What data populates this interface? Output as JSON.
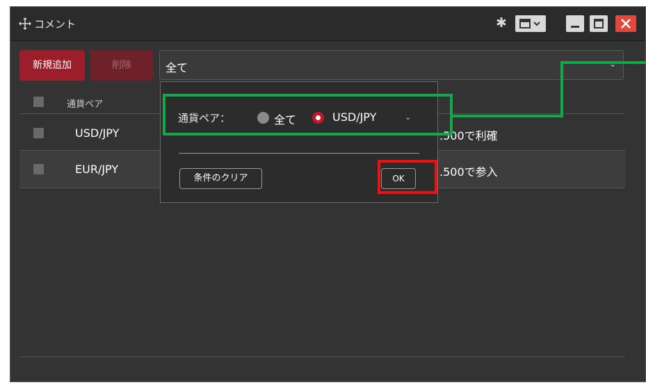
{
  "window": {
    "title": "コメント",
    "icons": [
      "move-icon",
      "gear-icon",
      "layout-icon",
      "minimize-icon",
      "maximize-icon",
      "close-icon"
    ]
  },
  "toolbar": {
    "add_label": "新規追加",
    "delete_label": "削除",
    "filter_value": "全て"
  },
  "grid": {
    "header": {
      "pair": "通貨ペア"
    },
    "rows": [
      {
        "pair": "USD/JPY",
        "comment": ".500で利確"
      },
      {
        "pair": "EUR/JPY",
        "comment": ".500で参入"
      }
    ]
  },
  "filter_popup": {
    "label": "通貨ペア：",
    "option_all": "全て",
    "option_selected": "USD/JPY",
    "selected": "USD/JPY",
    "clear_label": "条件のクリア",
    "ok_label": "OK"
  },
  "colors": {
    "accent": "#9b1e2a",
    "highlight_green": "#12a84a",
    "highlight_red": "#ee1111"
  }
}
